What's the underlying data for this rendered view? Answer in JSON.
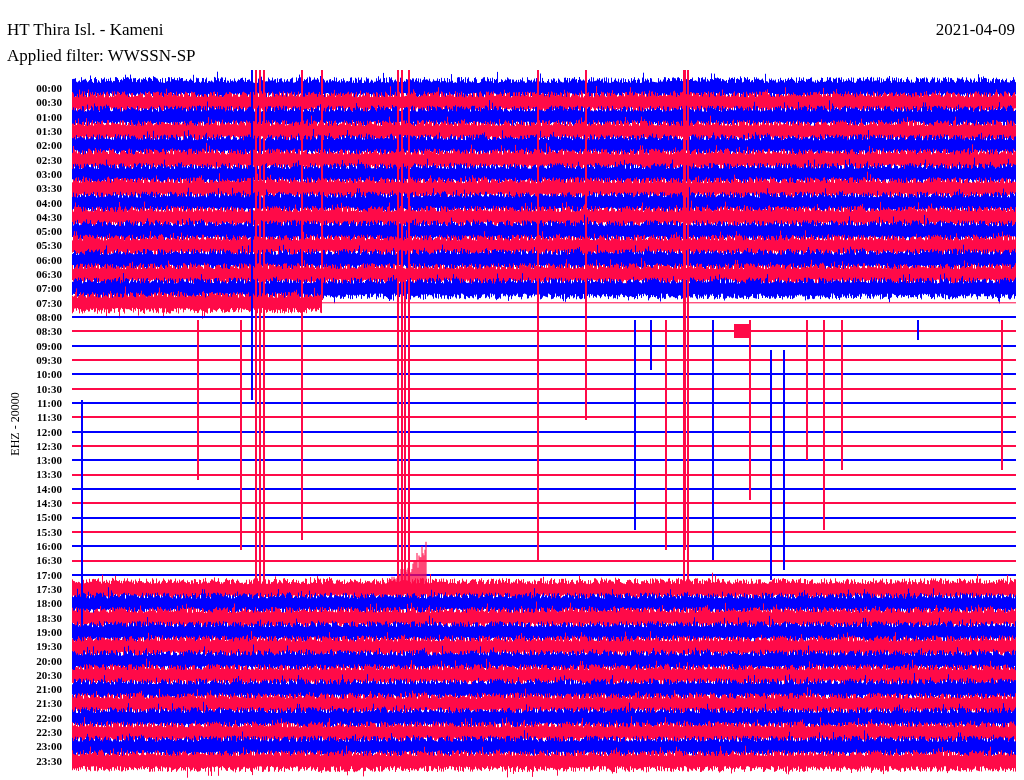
{
  "title": "HT Thira Isl. - Kameni",
  "date": "2021-04-09",
  "filter": "Applied filter: WWSSN-SP",
  "channel": "EHZ - 20000",
  "rows": [
    {
      "label": "00:00",
      "color": "#0000ff",
      "kind": "noisy"
    },
    {
      "label": "00:30",
      "color": "#ff0a48",
      "kind": "noisy"
    },
    {
      "label": "01:00",
      "color": "#0000ff",
      "kind": "noisy"
    },
    {
      "label": "01:30",
      "color": "#ff0a48",
      "kind": "noisy"
    },
    {
      "label": "02:00",
      "color": "#0000ff",
      "kind": "noisy"
    },
    {
      "label": "02:30",
      "color": "#ff0a48",
      "kind": "noisy"
    },
    {
      "label": "03:00",
      "color": "#0000ff",
      "kind": "noisy"
    },
    {
      "label": "03:30",
      "color": "#ff0a48",
      "kind": "noisy"
    },
    {
      "label": "04:00",
      "color": "#0000ff",
      "kind": "noisy"
    },
    {
      "label": "04:30",
      "color": "#ff0a48",
      "kind": "noisy"
    },
    {
      "label": "05:00",
      "color": "#0000ff",
      "kind": "noisy"
    },
    {
      "label": "05:30",
      "color": "#ff0a48",
      "kind": "noisy"
    },
    {
      "label": "06:00",
      "color": "#0000ff",
      "kind": "noisy"
    },
    {
      "label": "06:30",
      "color": "#ff0a48",
      "kind": "noisy"
    },
    {
      "label": "07:00",
      "color": "#0000ff",
      "kind": "noisy"
    },
    {
      "label": "07:30",
      "color": "#ff0a48",
      "kind": "partial"
    },
    {
      "label": "08:00",
      "color": "#0000ff",
      "kind": "quiet"
    },
    {
      "label": "08:30",
      "color": "#ff0a48",
      "kind": "quiet"
    },
    {
      "label": "09:00",
      "color": "#0000ff",
      "kind": "quiet"
    },
    {
      "label": "09:30",
      "color": "#ff0a48",
      "kind": "quiet"
    },
    {
      "label": "10:00",
      "color": "#0000ff",
      "kind": "quiet"
    },
    {
      "label": "10:30",
      "color": "#ff0a48",
      "kind": "quiet"
    },
    {
      "label": "11:00",
      "color": "#0000ff",
      "kind": "quiet"
    },
    {
      "label": "11:30",
      "color": "#ff0a48",
      "kind": "quiet"
    },
    {
      "label": "12:00",
      "color": "#0000ff",
      "kind": "quiet"
    },
    {
      "label": "12:30",
      "color": "#ff0a48",
      "kind": "quiet"
    },
    {
      "label": "13:00",
      "color": "#0000ff",
      "kind": "quiet"
    },
    {
      "label": "13:30",
      "color": "#ff0a48",
      "kind": "quiet"
    },
    {
      "label": "14:00",
      "color": "#0000ff",
      "kind": "quiet"
    },
    {
      "label": "14:30",
      "color": "#ff0a48",
      "kind": "quiet"
    },
    {
      "label": "15:00",
      "color": "#0000ff",
      "kind": "quiet"
    },
    {
      "label": "15:30",
      "color": "#ff0a48",
      "kind": "quiet"
    },
    {
      "label": "16:00",
      "color": "#0000ff",
      "kind": "quiet"
    },
    {
      "label": "16:30",
      "color": "#ff0a48",
      "kind": "quiet"
    },
    {
      "label": "17:00",
      "color": "#0000ff",
      "kind": "quiet"
    },
    {
      "label": "17:30",
      "color": "#ff0a48",
      "kind": "noisy"
    },
    {
      "label": "18:00",
      "color": "#0000ff",
      "kind": "noisy"
    },
    {
      "label": "18:30",
      "color": "#ff0a48",
      "kind": "noisy"
    },
    {
      "label": "19:00",
      "color": "#0000ff",
      "kind": "noisy"
    },
    {
      "label": "19:30",
      "color": "#ff0a48",
      "kind": "noisy"
    },
    {
      "label": "20:00",
      "color": "#0000ff",
      "kind": "noisy"
    },
    {
      "label": "20:30",
      "color": "#ff0a48",
      "kind": "noisy"
    },
    {
      "label": "21:00",
      "color": "#0000ff",
      "kind": "noisy"
    },
    {
      "label": "21:30",
      "color": "#ff0a48",
      "kind": "noisy"
    },
    {
      "label": "22:00",
      "color": "#0000ff",
      "kind": "noisy"
    },
    {
      "label": "22:30",
      "color": "#ff0a48",
      "kind": "noisy"
    },
    {
      "label": "23:00",
      "color": "#0000ff",
      "kind": "noisy"
    },
    {
      "label": "23:30",
      "color": "#ff0a48",
      "kind": "noisy"
    }
  ]
}
